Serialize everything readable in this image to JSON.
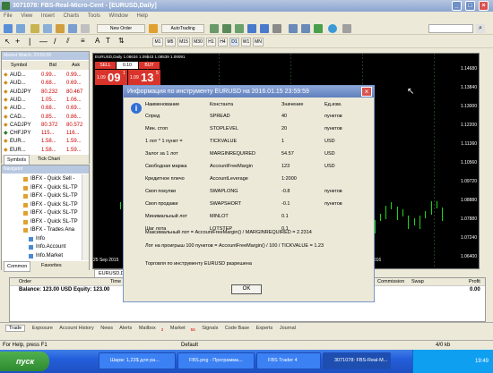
{
  "window": {
    "title": "3071078: FBS-Real-Micro-Cent - [EURUSD,Daily]"
  },
  "menu": [
    "File",
    "View",
    "Insert",
    "Charts",
    "Tools",
    "Window",
    "Help"
  ],
  "toolbar": {
    "new_order": "New Order",
    "autotrading": "AutoTrading",
    "timeframes": [
      "M1",
      "M5",
      "M15",
      "M30",
      "H1",
      "H4",
      "D1",
      "W1",
      "MN"
    ]
  },
  "market_watch": {
    "title": "Market Watch: 23:59:59",
    "headers": [
      "Symbol",
      "Bid",
      "Ask"
    ],
    "rows": [
      [
        "AUD...",
        "0.99...",
        "0.99..."
      ],
      [
        "AUD...",
        "0.68...",
        "0.69..."
      ],
      [
        "AUDJPY",
        "80.232",
        "80.467"
      ],
      [
        "AUD...",
        "1.05...",
        "1.06..."
      ],
      [
        "AUD...",
        "0.68...",
        "0.69..."
      ],
      [
        "CAD...",
        "0.85...",
        "0.86..."
      ],
      [
        "CADJPY",
        "80.372",
        "80.572"
      ],
      [
        "CHFJPY",
        "115...",
        "116..."
      ],
      [
        "EUR...",
        "1.58...",
        "1.59..."
      ],
      [
        "EUR...",
        "1.58...",
        "1.59..."
      ]
    ],
    "tabs": [
      "Symbols",
      "Tick Chart"
    ]
  },
  "navigator": {
    "title": "Navigator",
    "items": [
      "IBFX - Quick Sell - ",
      "IBFX - Quick SL-TP",
      "IBFX - Quick SL-TP",
      "IBFX - Quick SL-TP",
      "IBFX - Quick SL-TP",
      "IBFX - Quick SL-TP",
      "IBFX - Trades Ana",
      "Info",
      "Info.Account",
      "Info.Market"
    ],
    "tabs": [
      "Common",
      "Favorites"
    ]
  },
  "chart": {
    "info": "EURUSD,Daily 1.08634 1.09843 1.08539 1.09091",
    "sell_label": "SELL",
    "buy_label": "BUY",
    "lot": "0.10",
    "sell_price_small": "1.09",
    "sell_price_big": "09",
    "sell_price_sup": "1",
    "buy_price_small": "1.09",
    "buy_price_big": "13",
    "buy_price_sup": "5",
    "price_axis": [
      "1.14680",
      "1.13840",
      "1.13000",
      "1.12200",
      "1.11360",
      "1.10560",
      "1.09720",
      "1.08880",
      "1.07880",
      "1.07240",
      "1.06400"
    ],
    "time_axis_left": "25 Sep 2015",
    "time_axis_right": "2016",
    "tab": "EURUSD,Daily"
  },
  "dialog": {
    "title": "Информация по инструменту EURUSD на 2016.01.15 23:59:59",
    "headers": [
      "Наименование",
      "Константа",
      "Значение",
      "Ед.изм."
    ],
    "rows": [
      [
        "Спред",
        "SPREAD",
        "40",
        "пунктов"
      ],
      [
        "Мин. стоп",
        "STOPLEVEL",
        "20",
        "пунктов"
      ],
      [
        "1 лот * 1 пункт =",
        "TICKVALUE",
        "1",
        "USD"
      ],
      [
        "Залог за 1 лот",
        "MARGINREQUIRED",
        "54.57",
        "USD"
      ],
      [
        "Свободная маржа",
        "AccountFreeMargin",
        "123",
        "USD"
      ],
      [
        "Кредитное плечо",
        "AccountLeverage",
        "1:2000",
        ""
      ],
      [
        "Своп покупки",
        "SWAPLONG",
        "-0.8",
        "пунктов"
      ],
      [
        "Своп продажи",
        "SWAPSHORT",
        "-0.1",
        "пунктов"
      ],
      [
        "Минимальный лот",
        "MINLOT",
        "0.1",
        ""
      ],
      [
        "Шаг лота",
        "LOTSTEP",
        "0.1",
        ""
      ]
    ],
    "formula1": "Максимальный лот = AccountFreeMargin() / MARGINREQUIRED = 2.2314",
    "formula2": "Лот на проигрыш 100 пунктов = AccountFreeMargin() / 100 / TICKVALUE = 1.23",
    "trading_status": "Торговля по инструменту EURUSD разрешена",
    "ok": "OK"
  },
  "terminal": {
    "headers": [
      "Order",
      "Time",
      "Commission",
      "Swap",
      "Profit"
    ],
    "balance": "Balance: 123.00 USD  Equity: 123.00",
    "profit": "0.00",
    "tabs": [
      "Trade",
      "Exposure",
      "Account History",
      "News",
      "Alerts",
      "Mailbox",
      "Market",
      "Signals",
      "Code Base",
      "Experts",
      "Journal"
    ],
    "mailbox_count": "2",
    "market_count": "55"
  },
  "status": {
    "help": "For Help, press F1",
    "profile": "Default",
    "traffic": "4/0 kb"
  },
  "taskbar": {
    "start": "пуск",
    "items": [
      "Шарж: 1,23$ для ра...",
      "FBS.png - Программа...",
      "FBS Trader 4",
      "3071078: FBS-Real-M..."
    ],
    "clock": "19:49"
  }
}
